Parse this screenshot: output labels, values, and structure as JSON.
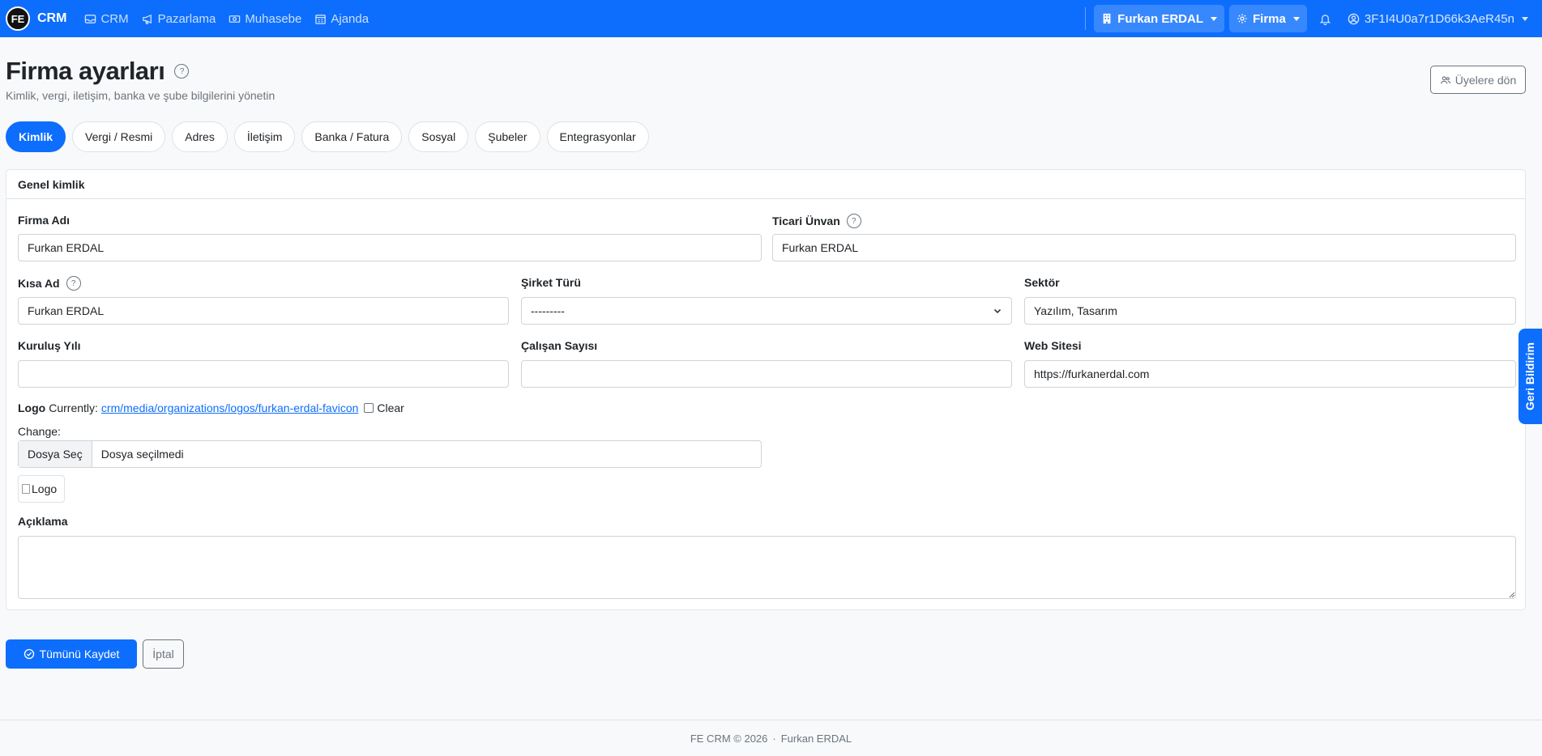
{
  "navbar": {
    "brand_logo": "FE",
    "brand": "CRM",
    "items": [
      {
        "label": "CRM",
        "icon": "inbox-icon"
      },
      {
        "label": "Pazarlama",
        "icon": "megaphone-icon"
      },
      {
        "label": "Muhasebe",
        "icon": "cash-icon"
      },
      {
        "label": "Ajanda",
        "icon": "calendar-icon"
      }
    ],
    "org_menu": "Furkan ERDAL",
    "settings_menu": "Firma",
    "user": "3F1I4U0a7r1D66k3AeR45n"
  },
  "header": {
    "title": "Firma ayarları",
    "help": "?",
    "subtitle": "Kimlik, vergi, iletişim, banka ve şube bilgilerini yönetin",
    "back_button": "Üyelere dön"
  },
  "tabs": [
    {
      "label": "Kimlik",
      "active": true
    },
    {
      "label": "Vergi / Resmi",
      "active": false
    },
    {
      "label": "Adres",
      "active": false
    },
    {
      "label": "İletişim",
      "active": false
    },
    {
      "label": "Banka / Fatura",
      "active": false
    },
    {
      "label": "Sosyal",
      "active": false
    },
    {
      "label": "Şubeler",
      "active": false
    },
    {
      "label": "Entegrasyonlar",
      "active": false
    }
  ],
  "card": {
    "title": "Genel kimlik",
    "fields": {
      "firma_adi": {
        "label": "Firma Adı",
        "value": "Furkan ERDAL"
      },
      "ticari_unvan": {
        "label": "Ticari Ünvan",
        "value": "Furkan ERDAL"
      },
      "kisa_ad": {
        "label": "Kısa Ad",
        "value": "Furkan ERDAL"
      },
      "sirket_turu": {
        "label": "Şirket Türü",
        "value": "---------"
      },
      "sektor": {
        "label": "Sektör",
        "value": "Yazılım, Tasarım"
      },
      "kurulus_yili": {
        "label": "Kuruluş Yılı",
        "value": ""
      },
      "calisan_sayisi": {
        "label": "Çalışan Sayısı",
        "value": ""
      },
      "web_sitesi": {
        "label": "Web Sitesi",
        "value": "https://furkanerdal.com"
      }
    },
    "logo": {
      "label": "Logo",
      "currently": "Currently:",
      "link": "crm/media/organizations/logos/furkan-erdal-favicon",
      "clear": "Clear",
      "change": "Change:",
      "file_button": "Dosya Seç",
      "file_name": "Dosya seçilmedi",
      "alt": "Logo"
    },
    "aciklama": {
      "label": "Açıklama",
      "value": ""
    }
  },
  "actions": {
    "save": "Tümünü Kaydet",
    "cancel": "İptal"
  },
  "footer": {
    "text": "FE CRM © 2026",
    "separator": "·",
    "owner": "Furkan ERDAL"
  },
  "feedback": "Geri Bildirim",
  "colors": {
    "primary": "#0d6efd",
    "background": "#f8f9fa",
    "border": "#ced4da",
    "muted": "#6c757d"
  }
}
